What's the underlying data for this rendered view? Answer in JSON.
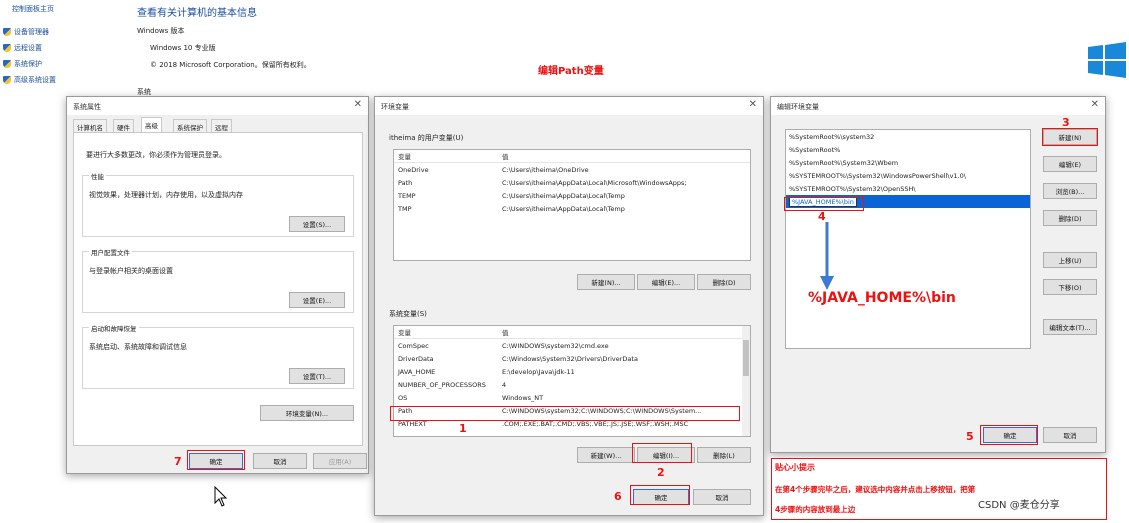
{
  "control_panel": {
    "home": "控制面板主页",
    "links": [
      "设备管理器",
      "远程设置",
      "系统保护",
      "高级系统设置"
    ],
    "heading": "查看有关计算机的基本信息",
    "edition_section": "Windows 版本",
    "edition": "Windows 10 专业版",
    "copyright": "© 2018 Microsoft Corporation。保留所有权利。",
    "system_section": "系统"
  },
  "annotation_title": "编辑Path变量",
  "sysprops": {
    "title": "系统属性",
    "tabs": [
      "计算机名",
      "硬件",
      "高级",
      "系统保护",
      "远程"
    ],
    "active_tab": "高级",
    "admin_note": "要进行大多数更改，你必须作为管理员登录。",
    "perf_label": "性能",
    "perf_desc": "视觉效果，处理器计划，内存使用，以及虚拟内存",
    "perf_btn": "设置(S)...",
    "profile_label": "用户配置文件",
    "profile_desc": "与登录帐户相关的桌面设置",
    "profile_btn": "设置(E)...",
    "startup_label": "启动和故障恢复",
    "startup_desc": "系统启动、系统故障和调试信息",
    "startup_btn": "设置(T)...",
    "env_btn": "环境变量(N)...",
    "ok": "确定",
    "cancel": "取消",
    "apply": "应用(A)"
  },
  "envvars": {
    "title": "环境变量",
    "user_label": "itheima 的用户变量(U)",
    "col_var": "变量",
    "col_val": "值",
    "user_rows": [
      {
        "name": "OneDrive",
        "value": "C:\\Users\\itheima\\OneDrive"
      },
      {
        "name": "Path",
        "value": "C:\\Users\\itheima\\AppData\\Local\\Microsoft\\WindowsApps;"
      },
      {
        "name": "TEMP",
        "value": "C:\\Users\\itheima\\AppData\\Local\\Temp"
      },
      {
        "name": "TMP",
        "value": "C:\\Users\\itheima\\AppData\\Local\\Temp"
      }
    ],
    "user_new": "新建(N)...",
    "user_edit": "编辑(E)...",
    "user_delete": "删除(D)",
    "sys_label": "系统变量(S)",
    "sys_rows": [
      {
        "name": "ComSpec",
        "value": "C:\\WINDOWS\\system32\\cmd.exe"
      },
      {
        "name": "DriverData",
        "value": "C:\\Windows\\System32\\Drivers\\DriverData"
      },
      {
        "name": "JAVA_HOME",
        "value": "E:\\develop\\Java\\jdk-11"
      },
      {
        "name": "NUMBER_OF_PROCESSORS",
        "value": "4"
      },
      {
        "name": "OS",
        "value": "Windows_NT"
      },
      {
        "name": "Path",
        "value": "C:\\WINDOWS\\system32;C:\\WINDOWS;C:\\WINDOWS\\System..."
      },
      {
        "name": "PATHEXT",
        "value": ".COM;.EXE;.BAT;.CMD;.VBS;.VBE;.JS;.JSE;.WSF;.WSH;.MSC"
      }
    ],
    "sys_new": "新建(W)...",
    "sys_edit": "编辑(I)...",
    "sys_delete": "删除(L)",
    "ok": "确定",
    "cancel": "取消"
  },
  "editenv": {
    "title": "编辑环境变量",
    "items": [
      "%SystemRoot%\\system32",
      "%SystemRoot%",
      "%SystemRoot%\\System32\\Wbem",
      "%SYSTEMROOT%\\System32\\WindowsPowerShell\\v1.0\\",
      "%SYSTEMROOT%\\System32\\OpenSSH\\",
      "%JAVA_HOME%\\bin"
    ],
    "selected_index": 5,
    "btn_new": "新建(N)",
    "btn_edit": "编辑(E)",
    "btn_browse": "浏览(B)...",
    "btn_delete": "删除(D)",
    "btn_up": "上移(U)",
    "btn_down": "下移(O)",
    "btn_edit_text": "编辑文本(T)...",
    "ok": "确定",
    "cancel": "取消",
    "big_label": "%JAVA_HOME%\\bin"
  },
  "steps": {
    "s1": "1",
    "s2": "2",
    "s3": "3",
    "s4": "4",
    "s5": "5",
    "s6": "6",
    "s7": "7"
  },
  "tip": {
    "title": "贴心小提示",
    "line1": "在第4个步骤完毕之后，建议选中内容并点击上移按钮，把第",
    "line2": "4步骤的内容放到最上边"
  },
  "watermark": "CSDN @麦仓分享",
  "colors": {
    "annotation_red": "#e11111",
    "selection_blue": "#0a64d8",
    "link_blue": "#1a4fa0",
    "arrow_blue": "#3b7bd4"
  }
}
